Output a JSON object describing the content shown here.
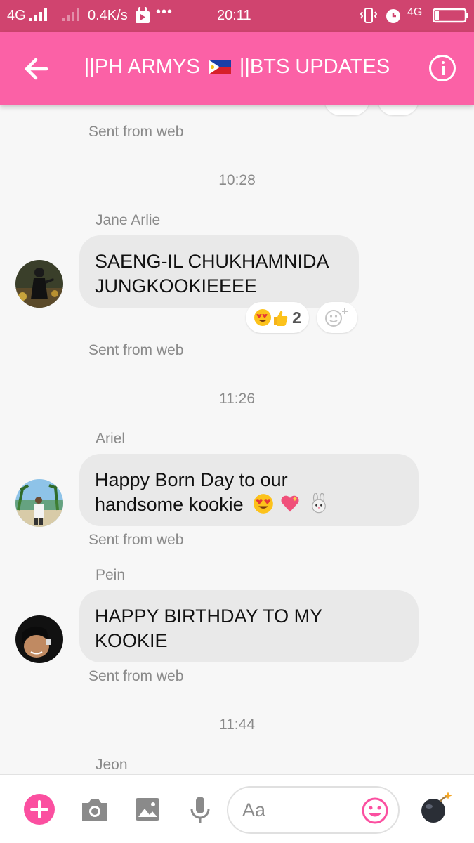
{
  "status_bar": {
    "network_label": "4G",
    "speed": "0.4K/s",
    "dots": "•••",
    "time": "20:11",
    "network_right": "4G"
  },
  "header": {
    "title_prefix": "||PH ARMYS",
    "title_suffix": "||BTS UPDATES",
    "accent_color": "#fb61a6"
  },
  "chat": {
    "top_sent_from": "Sent from web",
    "groups": [
      {
        "timestamp": "10:28",
        "sender": "Jane Arlie",
        "message_line1": "SAENG-IL CHUKHAMNIDA",
        "message_line2": "JUNGKOOKIEEEE",
        "reaction_count": "2",
        "sent_from": "Sent from web"
      },
      {
        "timestamp": "11:26",
        "sender": "Ariel",
        "message_line1": "Happy Born Day to our",
        "message_line2": "handsome kookie",
        "sent_from": "Sent from web"
      },
      {
        "sender": "Pein",
        "message_line1": "HAPPY BIRTHDAY TO MY",
        "message_line2": "KOOKIE",
        "sent_from": "Sent from web"
      },
      {
        "timestamp": "11:44",
        "sender": "Jeon"
      }
    ]
  },
  "composer": {
    "placeholder": "Aa",
    "icons": [
      "plus-icon",
      "camera-icon",
      "image-icon",
      "microphone-icon",
      "smiley-icon",
      "bomb-icon"
    ]
  }
}
